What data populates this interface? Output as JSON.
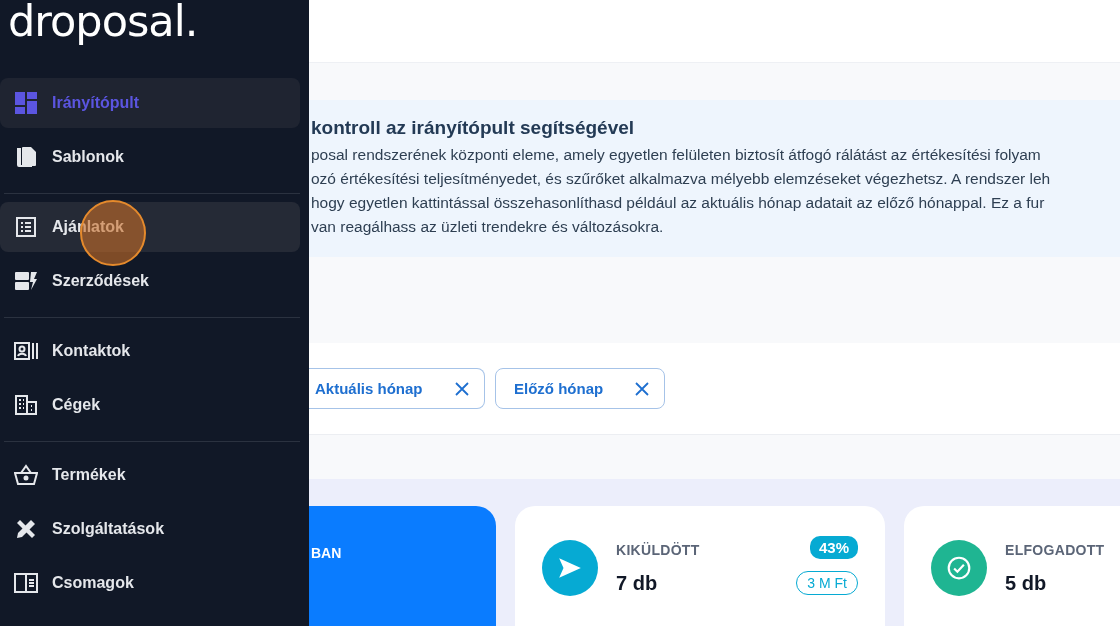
{
  "logo": "droposal.",
  "nav_groups": [
    [
      {
        "kind": "dashboard",
        "label": "Irányítópult",
        "selected": true,
        "hovered": false
      },
      {
        "kind": "templates",
        "label": "Sablonok",
        "selected": false,
        "hovered": false
      }
    ],
    [
      {
        "kind": "list",
        "label": "Ajánlatok",
        "selected": false,
        "hovered": true
      },
      {
        "kind": "contracts",
        "label": "Szerződések",
        "selected": false,
        "hovered": false
      }
    ],
    [
      {
        "kind": "contact",
        "label": "Kontaktok",
        "selected": false,
        "hovered": false
      },
      {
        "kind": "building",
        "label": "Cégek",
        "selected": false,
        "hovered": false
      }
    ],
    [
      {
        "kind": "basket",
        "label": "Termékek",
        "selected": false,
        "hovered": false
      },
      {
        "kind": "tools",
        "label": "Szolgáltatások",
        "selected": false,
        "hovered": false
      },
      {
        "kind": "panel",
        "label": "Csomagok",
        "selected": false,
        "hovered": false
      }
    ]
  ],
  "info": {
    "title": "kontroll az irányítópult segítségével",
    "paragraph_lines": [
      "posal rendszerének központi eleme, amely egyetlen felületen biztosít átfogó rálátást az értékesítési folyam",
      "ozó értékesítési teljesítményedet, és szűrőket alkalmazva mélyebb elemzéseket végezhetsz. A rendszer leh",
      "hogy egyetlen kattintással összehasonlíthasd például az aktuális hónap adatait az előző hónappal. Ez a fur",
      "van reagálhass az üzleti trendekre és változásokra."
    ]
  },
  "filters": [
    {
      "label": "Aktuális hónap"
    },
    {
      "label": "Előző hónap"
    }
  ],
  "cards": [
    {
      "kind": "highlight",
      "label": "BAN"
    },
    {
      "kind": "sent",
      "color": "#06aad3",
      "label": "KIKÜLDÖTT",
      "value": "7 db",
      "percent": "43%",
      "amount": "3 M Ft"
    },
    {
      "kind": "accepted",
      "color": "#1fb592",
      "label": "ELFOGADOTT",
      "value": "5 db"
    }
  ]
}
